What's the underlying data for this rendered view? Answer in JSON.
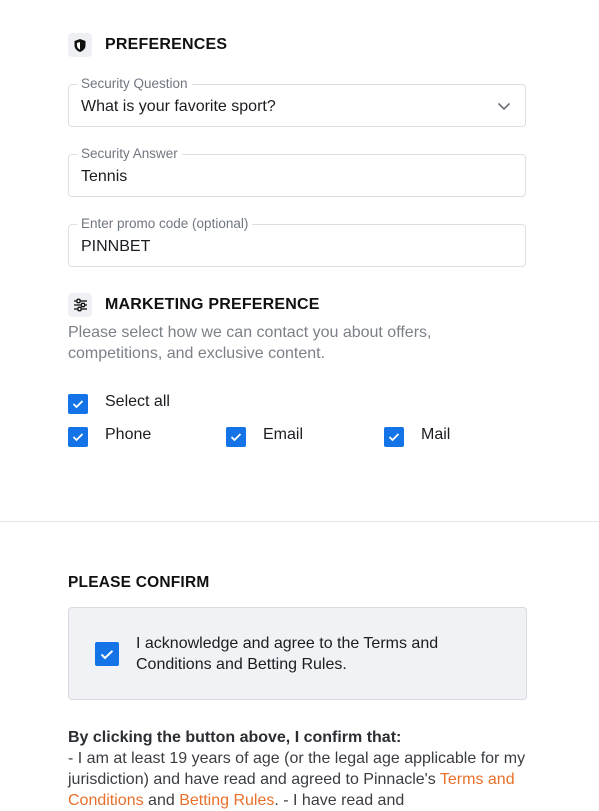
{
  "preferences": {
    "title": "PREFERENCES",
    "icon": "shield-icon",
    "security_question": {
      "label": "Security Question",
      "value": "What is your favorite sport?"
    },
    "security_answer": {
      "label": "Security Answer",
      "value": "Tennis"
    },
    "promo_code": {
      "label": "Enter promo code (optional)",
      "value": "PINNBET"
    }
  },
  "marketing": {
    "title": "MARKETING PREFERENCE",
    "icon": "sliders-icon",
    "description": "Please select how we can contact you about offers, competitions, and exclusive content.",
    "select_all": {
      "label": "Select all",
      "checked": true
    },
    "options": [
      {
        "label": "Phone",
        "checked": true
      },
      {
        "label": "Email",
        "checked": true
      },
      {
        "label": "Mail",
        "checked": true
      }
    ]
  },
  "confirm": {
    "title": "PLEASE CONFIRM",
    "checkbox_label": "I acknowledge and agree to the Terms and Conditions and Betting Rules.",
    "checked": true
  },
  "legal": {
    "heading": "By clicking the button above, I confirm that:",
    "line1": "- I am at least 19 years of age (or the legal age applicable for my jurisdiction) and have read and agreed to Pinnacle's ",
    "terms_link": "Terms and Conditions",
    "and": " and ",
    "rules_link": "Betting Rules",
    "line2": ". - I have read and"
  },
  "colors": {
    "checkbox": "#1473e6",
    "link": "#e8702a",
    "confirm_bg": "#f1f2f5"
  }
}
